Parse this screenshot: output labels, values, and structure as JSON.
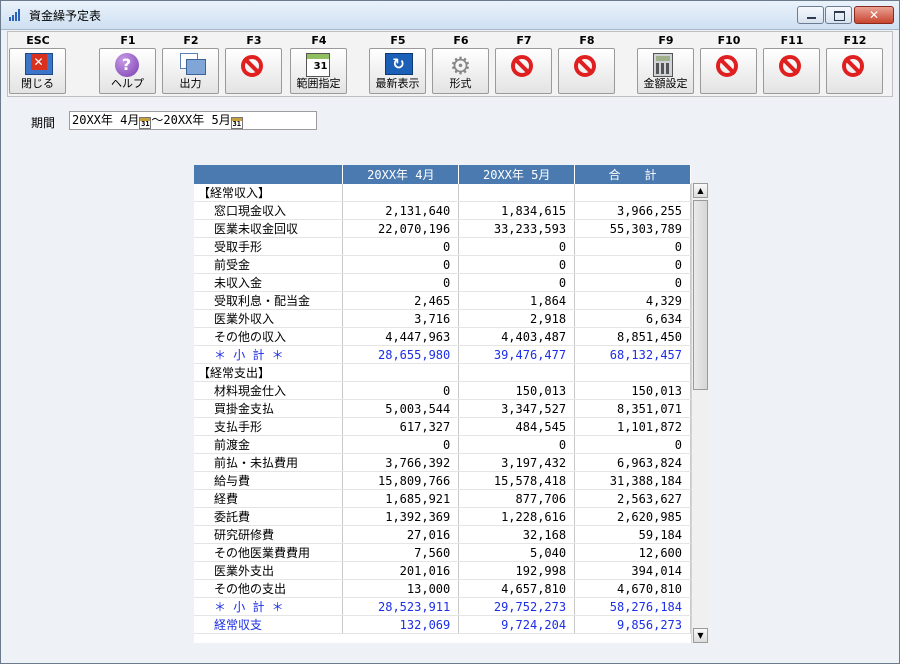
{
  "window": {
    "title": "資金繰予定表"
  },
  "toolbar": [
    {
      "key": "ESC",
      "label": "閉じる",
      "icon": "exit-icon"
    },
    {
      "key": "F1",
      "label": "ヘルプ",
      "icon": "help-icon"
    },
    {
      "key": "F2",
      "label": "出力",
      "icon": "print-icon"
    },
    {
      "key": "F3",
      "label": "",
      "icon": "no-icon"
    },
    {
      "key": "F4",
      "label": "範囲指定",
      "icon": "calendar-icon"
    },
    {
      "key": "F5",
      "label": "最新表示",
      "icon": "refresh-icon"
    },
    {
      "key": "F6",
      "label": "形式",
      "icon": "gear-icon"
    },
    {
      "key": "F7",
      "label": "",
      "icon": "no-icon"
    },
    {
      "key": "F8",
      "label": "",
      "icon": "no-icon"
    },
    {
      "key": "F9",
      "label": "金額設定",
      "icon": "calculator-icon"
    },
    {
      "key": "F10",
      "label": "",
      "icon": "no-icon"
    },
    {
      "key": "F11",
      "label": "",
      "icon": "no-icon"
    },
    {
      "key": "F12",
      "label": "",
      "icon": "no-icon"
    }
  ],
  "period": {
    "label": "期間",
    "from": "20XX年 4月",
    "separator": "～",
    "to": "20XX年 5月"
  },
  "table": {
    "columns": [
      "",
      "20XX年 4月",
      "20XX年 5月",
      "合　　計"
    ],
    "rows": [
      {
        "type": "section",
        "label": "【経常収入】",
        "values": [
          "",
          "",
          ""
        ]
      },
      {
        "type": "item",
        "label": "窓口現金収入",
        "values": [
          "2,131,640",
          "1,834,615",
          "3,966,255"
        ]
      },
      {
        "type": "item",
        "label": "医業未収金回収",
        "values": [
          "22,070,196",
          "33,233,593",
          "55,303,789"
        ]
      },
      {
        "type": "item",
        "label": "受取手形",
        "values": [
          "0",
          "0",
          "0"
        ]
      },
      {
        "type": "item",
        "label": "前受金",
        "values": [
          "0",
          "0",
          "0"
        ]
      },
      {
        "type": "item",
        "label": "未収入金",
        "values": [
          "0",
          "0",
          "0"
        ]
      },
      {
        "type": "item",
        "label": "受取利息・配当金",
        "values": [
          "2,465",
          "1,864",
          "4,329"
        ]
      },
      {
        "type": "item",
        "label": "医業外収入",
        "values": [
          "3,716",
          "2,918",
          "6,634"
        ]
      },
      {
        "type": "item",
        "label": "その他の収入",
        "values": [
          "4,447,963",
          "4,403,487",
          "8,851,450"
        ]
      },
      {
        "type": "subtotal",
        "label": "＊ 小 計 ＊",
        "values": [
          "28,655,980",
          "39,476,477",
          "68,132,457"
        ]
      },
      {
        "type": "section",
        "label": "【経常支出】",
        "values": [
          "",
          "",
          ""
        ]
      },
      {
        "type": "item",
        "label": "材料現金仕入",
        "values": [
          "0",
          "150,013",
          "150,013"
        ]
      },
      {
        "type": "item",
        "label": "買掛金支払",
        "values": [
          "5,003,544",
          "3,347,527",
          "8,351,071"
        ]
      },
      {
        "type": "item",
        "label": "支払手形",
        "values": [
          "617,327",
          "484,545",
          "1,101,872"
        ]
      },
      {
        "type": "item",
        "label": "前渡金",
        "values": [
          "0",
          "0",
          "0"
        ]
      },
      {
        "type": "item",
        "label": "前払・未払費用",
        "values": [
          "3,766,392",
          "3,197,432",
          "6,963,824"
        ]
      },
      {
        "type": "item",
        "label": "給与費",
        "values": [
          "15,809,766",
          "15,578,418",
          "31,388,184"
        ]
      },
      {
        "type": "item",
        "label": "経費",
        "values": [
          "1,685,921",
          "877,706",
          "2,563,627"
        ]
      },
      {
        "type": "item",
        "label": "委託費",
        "values": [
          "1,392,369",
          "1,228,616",
          "2,620,985"
        ]
      },
      {
        "type": "item",
        "label": "研究研修費",
        "values": [
          "27,016",
          "32,168",
          "59,184"
        ]
      },
      {
        "type": "item",
        "label": "その他医業費費用",
        "values": [
          "7,560",
          "5,040",
          "12,600"
        ]
      },
      {
        "type": "item",
        "label": "医業外支出",
        "values": [
          "201,016",
          "192,998",
          "394,014"
        ]
      },
      {
        "type": "item",
        "label": "その他の支出",
        "values": [
          "13,000",
          "4,657,810",
          "4,670,810"
        ]
      },
      {
        "type": "subtotal",
        "label": "＊ 小 計 ＊",
        "values": [
          "28,523,911",
          "29,752,273",
          "58,276,184"
        ]
      },
      {
        "type": "subtotal",
        "label": "経常収支",
        "values": [
          "132,069",
          "9,724,204",
          "9,856,273"
        ]
      }
    ]
  },
  "colors": {
    "header_bg": "#4a7ab0",
    "subtotal_text": "#1c2ee6",
    "no_icon": "#e02020"
  }
}
